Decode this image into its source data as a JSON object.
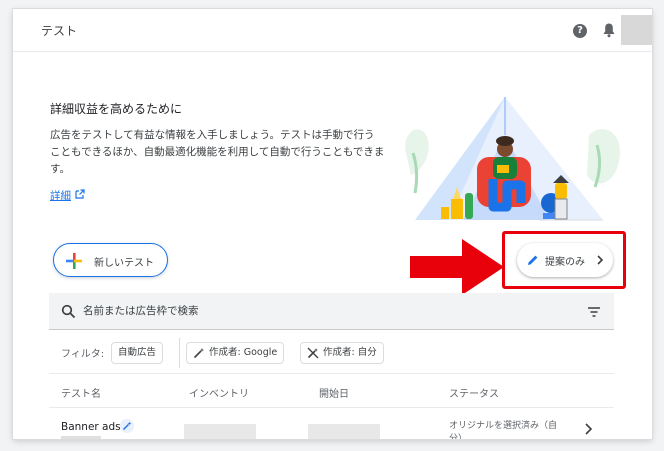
{
  "header": {
    "title": "テスト",
    "help_glyph": "?",
    "icons": [
      "help-icon",
      "bell-icon",
      "avatar"
    ]
  },
  "promo": {
    "heading": "詳細収益を高めるために",
    "body": "広告をテストして有益な情報を入手しましょう。テストは手動で行うこともできるほか、自動最適化機能を利用して自動で行うこともできます。",
    "link": "詳細"
  },
  "actions": {
    "new_test": "新しいテスト",
    "suggestions_only": "提案のみ"
  },
  "search": {
    "placeholder": "名前または広告枠で検索"
  },
  "filters": {
    "label": "フィルタ:",
    "chips": [
      "自動広告",
      "作成者: Google",
      "作成者: 自分"
    ]
  },
  "table": {
    "columns": [
      "テスト名",
      "インベントリ",
      "開始日",
      "ステータス"
    ],
    "rows": [
      {
        "name": "Banner ads",
        "status": "オリジナルを選択済み（自分）"
      }
    ]
  },
  "colors": {
    "accent": "#1a73e8",
    "highlight": "#e8000a",
    "text": "#202124"
  }
}
